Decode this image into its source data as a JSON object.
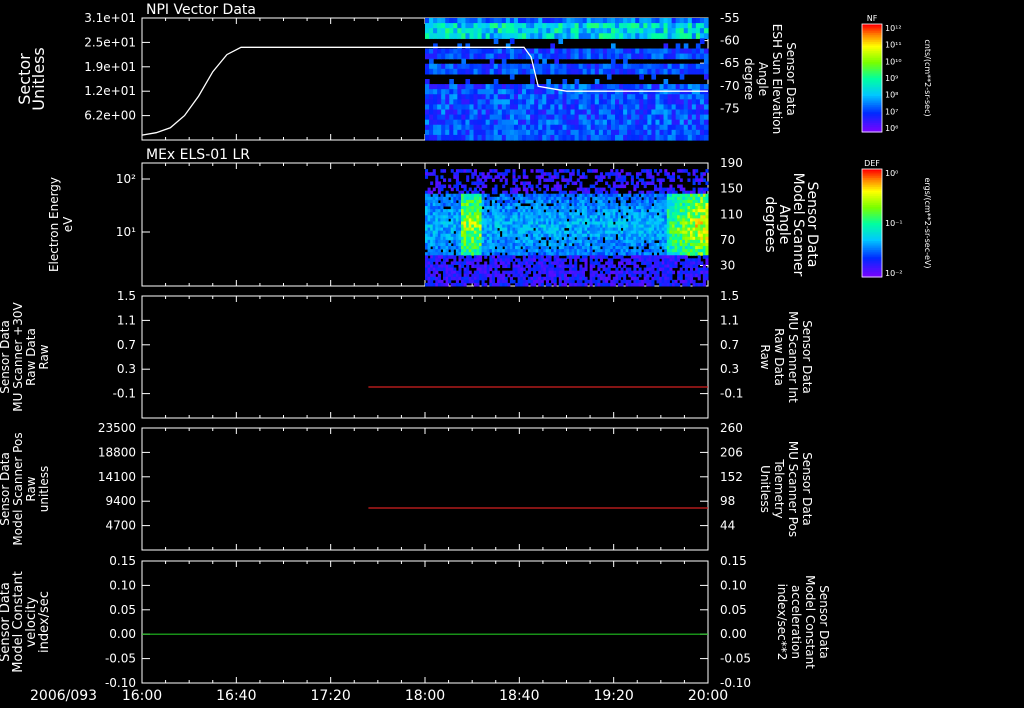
{
  "date_label": "2006/093",
  "time_ticks": [
    "16:00",
    "16:40",
    "17:20",
    "18:00",
    "18:40",
    "19:20",
    "20:00"
  ],
  "time_range": [
    "16:00",
    "20:00"
  ],
  "colors": {
    "background": "#000000",
    "axes": "#ffffff",
    "red": "#d42020",
    "green": "#20c020"
  },
  "chart_data": [
    {
      "type": "heatmap",
      "title": "NPI Vector Data",
      "ylabel_left": [
        "Sector",
        "Unitless"
      ],
      "ylabel_right": [
        "Sensor Data",
        "ESH Sun Elevation",
        "Angle",
        "degree"
      ],
      "left_ticks": [
        "3.1e+01",
        "2.5e+01",
        "1.9e+01",
        "1.2e+01",
        "6.2e+00"
      ],
      "right_ticks": [
        "-55",
        "-60",
        "-65",
        "-70",
        "-75"
      ],
      "ylim_right": [
        -80,
        -55
      ],
      "data_start": "18:00",
      "line_series": {
        "x_hours": [
          16.0,
          16.1,
          16.2,
          16.3,
          16.4,
          16.5,
          16.6,
          16.7,
          16.8,
          16.9,
          18.6,
          18.7,
          18.75,
          18.8,
          19.0,
          20.0
        ],
        "y": [
          -79,
          -78.5,
          -77.5,
          -75,
          -71,
          -66,
          -62.5,
          -61,
          -61,
          -61,
          -61,
          -61,
          -63,
          -69,
          -70,
          -70
        ]
      },
      "colorbar": {
        "label": "NF",
        "units": "cnts/(cm**2-sr-sec)",
        "ticks": [
          "10¹²",
          "10¹¹",
          "10¹⁰",
          "10⁹",
          "10⁸",
          "10⁷",
          "10⁶"
        ]
      }
    },
    {
      "type": "heatmap",
      "title": "MEx ELS-01 LR",
      "ylabel_left": [
        "Electron Energy",
        "eV"
      ],
      "ylabel_right": [
        "Sensor Data",
        "Model Scanner",
        "Angle",
        "degrees"
      ],
      "left_ticks": [
        "10²",
        "10¹"
      ],
      "right_ticks": [
        "190",
        "150",
        "110",
        "70",
        "30"
      ],
      "ylim_right": [
        0,
        190
      ],
      "data_start": "18:00",
      "colorbar": {
        "label": "DEF",
        "units": "ergs/(cm**2-sr-sec-eV)",
        "ticks": [
          "10⁰",
          "10⁻¹",
          "10⁻²"
        ]
      }
    },
    {
      "type": "line",
      "ylabel_left": [
        "Sensor Data",
        "MU Scanner +30V",
        "Raw Data",
        "Raw"
      ],
      "ylabel_right": [
        "Sensor Data",
        "MU Scanner Int",
        "Raw Data",
        "Raw"
      ],
      "left_ticks": [
        "1.5",
        "1.1",
        "0.7",
        "0.3",
        "-0.1"
      ],
      "right_ticks": [
        "1.5",
        "1.1",
        "0.7",
        "0.3",
        "-0.1"
      ],
      "ylim": [
        -0.5,
        1.5
      ],
      "series": [
        {
          "color": "#d42020",
          "x_hours": [
            17.6,
            20.0
          ],
          "y": [
            0.0,
            0.0
          ]
        }
      ]
    },
    {
      "type": "line",
      "ylabel_left": [
        "Sensor Data",
        "Model Scanner Pos",
        "Raw",
        "unitless"
      ],
      "ylabel_right": [
        "Sensor Data",
        "MU Scanner Pos",
        "Telemetry",
        "Unitless"
      ],
      "left_ticks": [
        "23500",
        "18800",
        "14100",
        "9400",
        "4700"
      ],
      "right_ticks": [
        "260",
        "206",
        "152",
        "98",
        "44"
      ],
      "ylim_left": [
        0,
        23500
      ],
      "ylim_right": [
        0,
        260
      ],
      "series": [
        {
          "color": "#d42020",
          "x_hours": [
            17.6,
            20.0
          ],
          "y_right": [
            82,
            82
          ]
        }
      ]
    },
    {
      "type": "line",
      "ylabel_left": [
        "Sensor Data",
        "Model Constant",
        "velocity",
        "index/sec"
      ],
      "ylabel_right": [
        "Sensor Data",
        "Model Constant",
        "acceleration",
        "index/sec**2"
      ],
      "left_ticks": [
        "0.15",
        "0.10",
        "0.05",
        "0.00",
        "-0.05",
        "-0.10"
      ],
      "right_ticks": [
        "0.15",
        "0.10",
        "0.05",
        "0.00",
        "-0.05",
        "-0.10"
      ],
      "ylim": [
        -0.1,
        0.15
      ],
      "series": [
        {
          "color": "#20c020",
          "x_hours": [
            16.0,
            20.0
          ],
          "y": [
            0.0,
            0.0
          ]
        }
      ]
    }
  ]
}
